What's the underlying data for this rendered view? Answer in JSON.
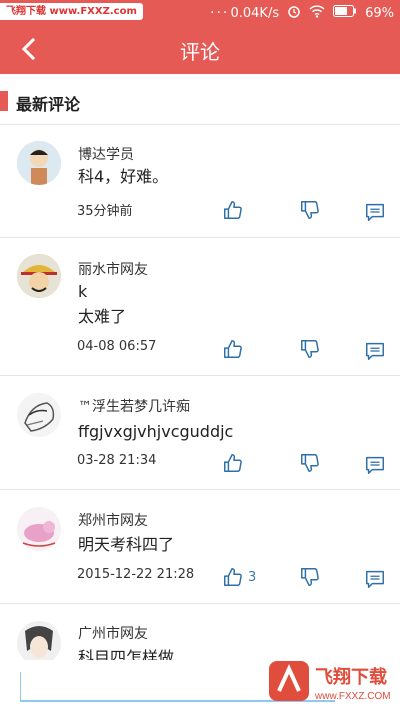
{
  "status_bar": {
    "site_tag": "飞翔下载 www.FXXZ.com",
    "dots": "...",
    "network_speed": "0.04K/s",
    "battery_percent": "69%"
  },
  "header": {
    "title": "评论"
  },
  "section": {
    "title": "最新评论"
  },
  "comments": [
    {
      "name": "博达学员",
      "lines": [
        "科4，好难。"
      ],
      "time": "35分钟前",
      "like_count": ""
    },
    {
      "name": "丽水市网友",
      "lines": [
        "k",
        "太难了"
      ],
      "time": "04-08 06:57",
      "like_count": ""
    },
    {
      "name": "™浮生若梦几许痴",
      "lines": [
        "ffgjvxgjvhjvcguddjc"
      ],
      "time": "03-28 21:34",
      "like_count": ""
    },
    {
      "name": "郑州市网友",
      "lines": [
        "明天考科四了"
      ],
      "time": "2015-12-22 21:28",
      "like_count": "3"
    },
    {
      "name": "广州市网友",
      "lines": [
        "科目四怎样做"
      ],
      "time": "",
      "like_count": ""
    }
  ],
  "input": {
    "placeholder": ""
  },
  "watermark": {
    "text": "飞翔下载",
    "url": "www.FXXZ.COM"
  },
  "colors": {
    "accent": "#e55a55",
    "icon": "#2f6fa8",
    "count": "#3a7cb8"
  }
}
